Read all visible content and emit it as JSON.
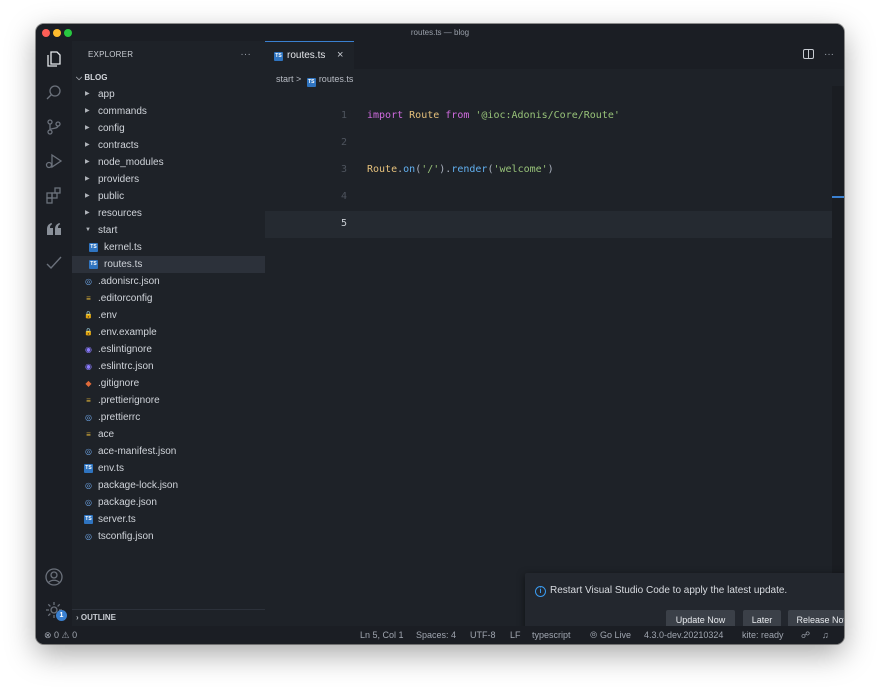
{
  "window": {
    "title": "routes.ts — blog"
  },
  "activity_bar": {
    "items": [
      {
        "name": "explorer-icon"
      },
      {
        "name": "search-icon"
      },
      {
        "name": "source-control-icon"
      },
      {
        "name": "run-debug-icon"
      },
      {
        "name": "extensions-icon"
      },
      {
        "name": "quotes-icon"
      },
      {
        "name": "check-icon"
      }
    ],
    "bottom": [
      {
        "name": "account-icon"
      },
      {
        "name": "manage-gear-icon"
      }
    ],
    "manage_badge": "1"
  },
  "explorer": {
    "header": "EXPLORER",
    "more": "···",
    "root": "BLOG",
    "items": [
      {
        "label": "app",
        "type": "folder",
        "depth": 1
      },
      {
        "label": "commands",
        "type": "folder",
        "depth": 1
      },
      {
        "label": "config",
        "type": "folder",
        "depth": 1
      },
      {
        "label": "contracts",
        "type": "folder",
        "depth": 1
      },
      {
        "label": "node_modules",
        "type": "folder",
        "depth": 1
      },
      {
        "label": "providers",
        "type": "folder",
        "depth": 1
      },
      {
        "label": "public",
        "type": "folder",
        "depth": 1
      },
      {
        "label": "resources",
        "type": "folder",
        "depth": 1
      },
      {
        "label": "start",
        "type": "folder-open",
        "depth": 1
      },
      {
        "label": "kernel.ts",
        "type": "ts",
        "depth": 2
      },
      {
        "label": "routes.ts",
        "type": "ts",
        "depth": 2,
        "selected": true
      },
      {
        "label": ".adonisrc.json",
        "type": "circ",
        "depth": 1
      },
      {
        "label": ".editorconfig",
        "type": "eq",
        "depth": 1
      },
      {
        "label": ".env",
        "type": "lock",
        "depth": 1
      },
      {
        "label": ".env.example",
        "type": "lock",
        "depth": 1
      },
      {
        "label": ".eslintignore",
        "type": "ring",
        "depth": 1
      },
      {
        "label": ".eslintrc.json",
        "type": "ring",
        "depth": 1
      },
      {
        "label": ".gitignore",
        "type": "git",
        "depth": 1
      },
      {
        "label": ".prettierignore",
        "type": "eq",
        "depth": 1
      },
      {
        "label": ".prettierrc",
        "type": "circ",
        "depth": 1
      },
      {
        "label": "ace",
        "type": "eq",
        "depth": 1
      },
      {
        "label": "ace-manifest.json",
        "type": "circ",
        "depth": 1
      },
      {
        "label": "env.ts",
        "type": "ts",
        "depth": 1
      },
      {
        "label": "package-lock.json",
        "type": "circ",
        "depth": 1
      },
      {
        "label": "package.json",
        "type": "circ",
        "depth": 1
      },
      {
        "label": "server.ts",
        "type": "ts",
        "depth": 1
      },
      {
        "label": "tsconfig.json",
        "type": "circ",
        "depth": 1
      }
    ],
    "outline": "OUTLINE"
  },
  "editor": {
    "tab": {
      "label": "routes.ts",
      "icon": "TS",
      "close": "×"
    },
    "more": "···",
    "breadcrumb": {
      "folder": "start",
      "sep": ">",
      "file": "routes.ts"
    },
    "lines": [
      {
        "num": "1",
        "tokens": [
          [
            "kw",
            "import "
          ],
          [
            "cls",
            "Route"
          ],
          [
            "kw",
            " from "
          ],
          [
            "str",
            "'@ioc:Adonis/Core/Route'"
          ]
        ]
      },
      {
        "num": "2",
        "tokens": []
      },
      {
        "num": "3",
        "tokens": [
          [
            "cls",
            "Route"
          ],
          [
            "punc",
            "."
          ],
          [
            "fn",
            "on"
          ],
          [
            "punc",
            "("
          ],
          [
            "str",
            "'/'"
          ],
          [
            "punc",
            ")."
          ],
          [
            "fn",
            "render"
          ],
          [
            "punc",
            "("
          ],
          [
            "str",
            "'welcome'"
          ],
          [
            "punc",
            ")"
          ]
        ]
      },
      {
        "num": "4",
        "tokens": []
      },
      {
        "num": "5",
        "tokens": [],
        "current": true
      }
    ]
  },
  "notification": {
    "icon": "i",
    "message": "Restart Visual Studio Code to apply the latest update.",
    "close": "×",
    "buttons": {
      "update": "Update Now",
      "later": "Later",
      "notes": "Release Notes"
    }
  },
  "status_bar": {
    "problems": "⊗ 0 ⚠ 0",
    "position": "Ln 5, Col 1",
    "spaces": "Spaces: 4",
    "encoding": "UTF-8",
    "eol": "LF",
    "language": "typescript",
    "go_live": "Go Live",
    "version": "4.3.0-dev.20210324",
    "kite": "kite: ready"
  }
}
